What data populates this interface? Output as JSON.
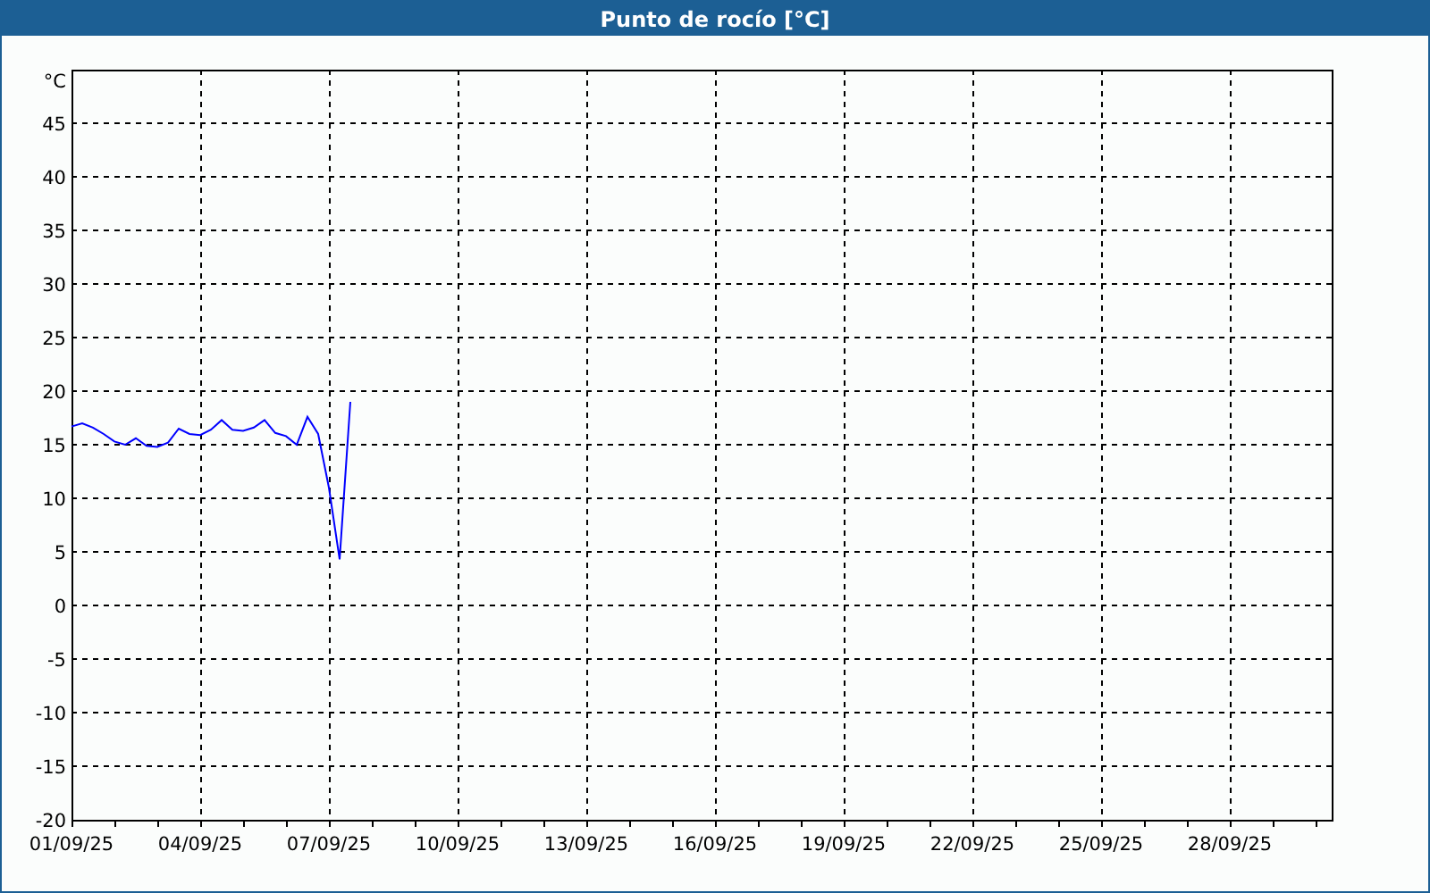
{
  "window": {
    "title": "Punto de rocío [°C]"
  },
  "chart": {
    "chart_data": {
      "type": "line",
      "grid": true,
      "ylabel": "°C",
      "ylim": [
        -20,
        50
      ],
      "yticks": [
        -20,
        -15,
        -10,
        -5,
        0,
        5,
        10,
        15,
        20,
        25,
        30,
        35,
        40,
        45
      ],
      "categories": [
        "01/09/25",
        null,
        null,
        null,
        null,
        null,
        null,
        null,
        null,
        null,
        null,
        null,
        "04/09/25",
        null,
        null,
        null,
        null,
        null,
        null,
        null,
        null,
        null,
        null,
        null,
        "07/09/25",
        null,
        null,
        null,
        null,
        null,
        null,
        null,
        null,
        null,
        null,
        null,
        "10/09/25",
        null,
        null,
        null,
        null,
        null,
        null,
        null,
        null,
        null,
        null,
        null,
        "13/09/25",
        null,
        null,
        null,
        null,
        null,
        null,
        null,
        null,
        null,
        null,
        null,
        "16/09/25",
        null,
        null,
        null,
        null,
        null,
        null,
        null,
        null,
        null,
        null,
        null,
        "19/09/25",
        null,
        null,
        null,
        null,
        null,
        null,
        null,
        null,
        null,
        null,
        null,
        "22/09/25",
        null,
        null,
        null,
        null,
        null,
        null,
        null,
        null,
        null,
        null,
        null,
        "25/09/25",
        null,
        null,
        null,
        null,
        null,
        null,
        null,
        null,
        null,
        null,
        null,
        "28/09/25",
        null,
        null,
        null,
        null,
        null,
        null,
        null,
        null,
        null
      ],
      "series": [
        {
          "color": "#0000ff",
          "values": [
            16.7,
            17.0,
            16.6,
            16.0,
            15.3,
            15.0,
            15.6,
            14.9,
            14.8,
            15.2,
            16.5,
            16.0,
            15.9,
            16.4,
            17.3,
            16.4,
            16.3,
            16.6,
            17.3,
            16.1,
            15.8,
            15.0,
            17.6,
            16.0,
            11.0,
            4.3,
            19.0,
            null,
            null,
            null,
            null,
            null,
            null,
            null,
            null,
            null,
            null,
            null,
            null,
            null,
            null,
            null,
            null,
            null,
            null,
            null,
            null,
            null,
            null,
            null,
            null,
            null,
            null,
            null,
            null,
            null,
            null,
            null,
            null,
            null,
            null,
            null,
            null,
            null,
            null,
            null,
            null,
            null,
            null,
            null,
            null,
            null,
            null,
            null,
            null,
            null,
            null,
            null,
            null,
            null,
            null,
            null,
            null,
            null,
            null,
            null,
            null,
            null,
            null,
            null,
            null,
            null,
            null,
            null,
            null,
            null,
            null,
            null,
            null,
            null,
            null,
            null,
            null,
            null,
            null,
            null,
            null,
            null,
            null,
            null,
            null,
            null,
            null,
            null,
            null,
            null,
            null,
            null
          ]
        }
      ]
    }
  }
}
